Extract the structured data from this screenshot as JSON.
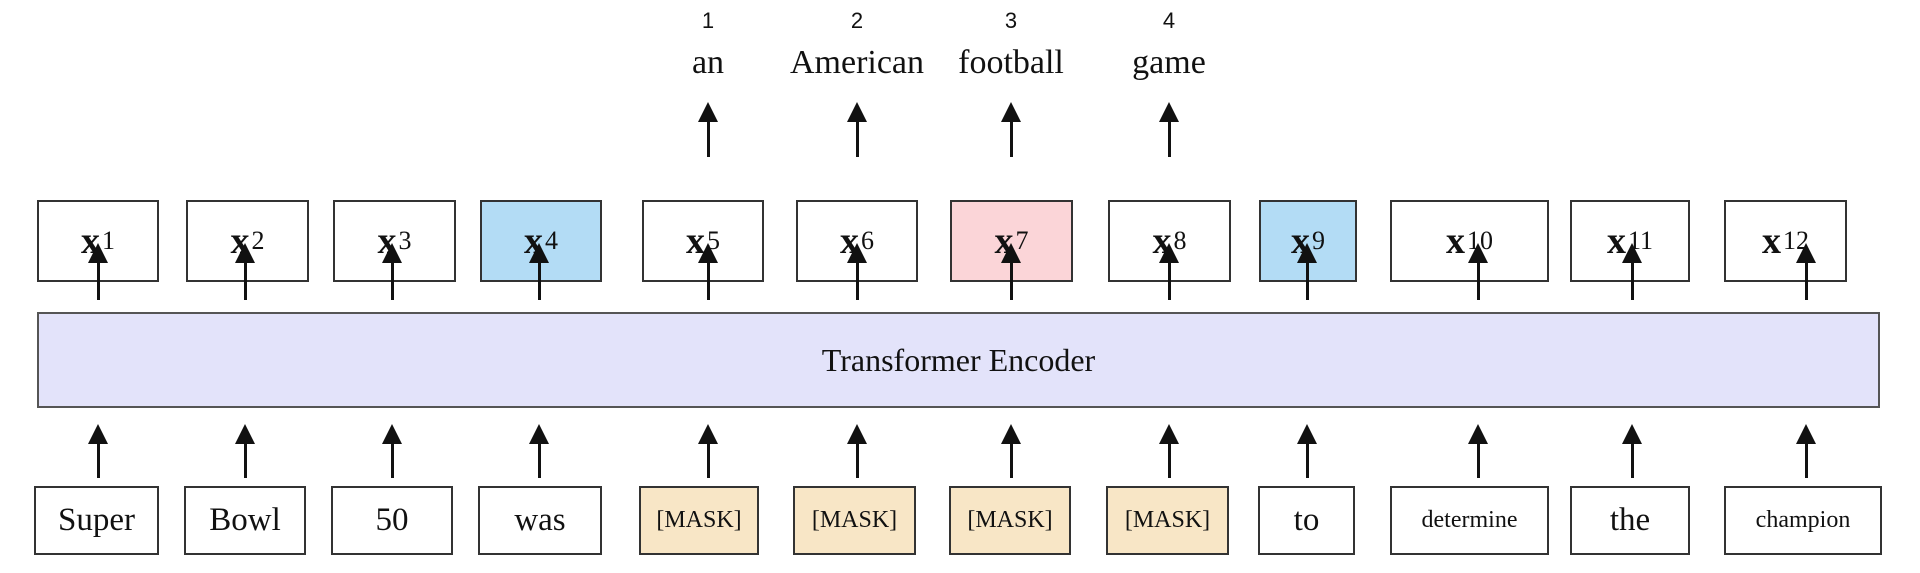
{
  "colors": {
    "encoder_fill": "#e3e3fa",
    "output_highlight_blue": "#b3dcf5",
    "output_highlight_pink": "#fbd5d8",
    "mask_fill": "#f8e6c6",
    "default_fill": "#ffffff"
  },
  "encoder": {
    "label": "Transformer Encoder"
  },
  "outputs": [
    {
      "base": "x",
      "sub": "1",
      "highlight": "none"
    },
    {
      "base": "x",
      "sub": "2",
      "highlight": "none"
    },
    {
      "base": "x",
      "sub": "3",
      "highlight": "none"
    },
    {
      "base": "x",
      "sub": "4",
      "highlight": "blue"
    },
    {
      "base": "x",
      "sub": "5",
      "highlight": "none"
    },
    {
      "base": "x",
      "sub": "6",
      "highlight": "none"
    },
    {
      "base": "x",
      "sub": "7",
      "highlight": "pink"
    },
    {
      "base": "x",
      "sub": "8",
      "highlight": "none"
    },
    {
      "base": "x",
      "sub": "9",
      "highlight": "blue"
    },
    {
      "base": "x",
      "sub": "10",
      "highlight": "none"
    },
    {
      "base": "x",
      "sub": "11",
      "highlight": "none"
    },
    {
      "base": "x",
      "sub": "12",
      "highlight": "none"
    }
  ],
  "inputs": [
    {
      "token": "Super",
      "masked": false
    },
    {
      "token": "Bowl",
      "masked": false
    },
    {
      "token": "50",
      "masked": false
    },
    {
      "token": "was",
      "masked": false
    },
    {
      "token": "[MASK]",
      "masked": true
    },
    {
      "token": "[MASK]",
      "masked": true
    },
    {
      "token": "[MASK]",
      "masked": true
    },
    {
      "token": "[MASK]",
      "masked": true
    },
    {
      "token": "to",
      "masked": false
    },
    {
      "token": "determine",
      "masked": false
    },
    {
      "token": "the",
      "masked": false
    },
    {
      "token": "champion",
      "masked": false
    }
  ],
  "predictions": [
    {
      "position": 5,
      "rank": "1",
      "word": "an"
    },
    {
      "position": 6,
      "rank": "2",
      "word": "American"
    },
    {
      "position": 7,
      "rank": "3",
      "word": "football"
    },
    {
      "position": 8,
      "rank": "4",
      "word": "game"
    }
  ]
}
